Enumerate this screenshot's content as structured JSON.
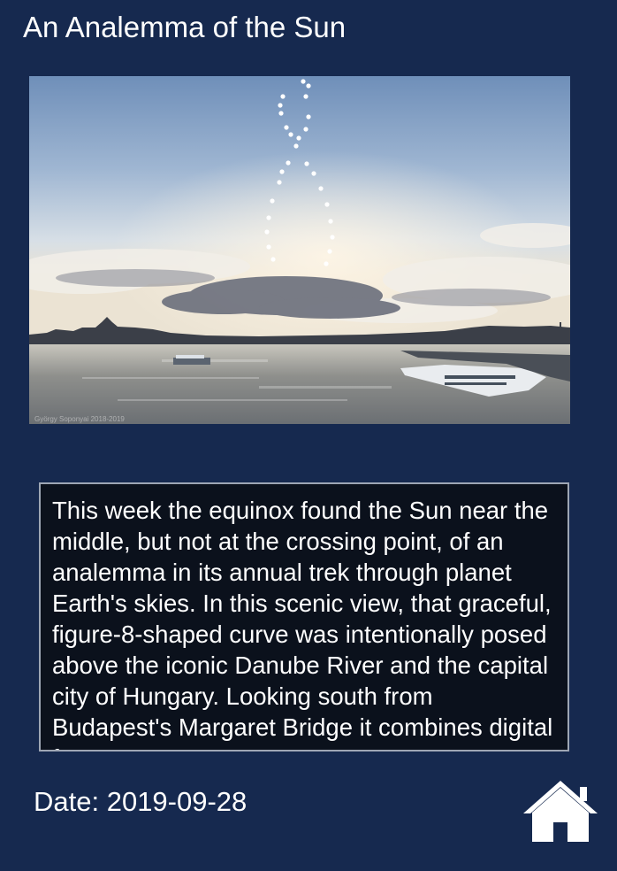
{
  "page": {
    "title": "An Analemma of the Sun"
  },
  "image": {
    "subject": "Analemma of the Sun over the Danube River, Budapest",
    "watermark": "György Soponyai 2018-2019"
  },
  "description": {
    "text": "This week the equinox found the Sun near the middle, but not at the crossing point, of an analemma in its annual trek through planet Earth's skies. In this scenic view, that graceful, figure-8-shaped curve was intentionally posed above the iconic Danube River and the capital city of Hungary. Looking south from Budapest's Margaret Bridge it combines digital frames"
  },
  "footer": {
    "date_label": "Date: 2019-09-28",
    "home_icon": "home-icon"
  },
  "colors": {
    "background": "#16294f",
    "description_background": "#0b111c",
    "description_border": "#9ea6b4",
    "text": "#ffffff"
  }
}
